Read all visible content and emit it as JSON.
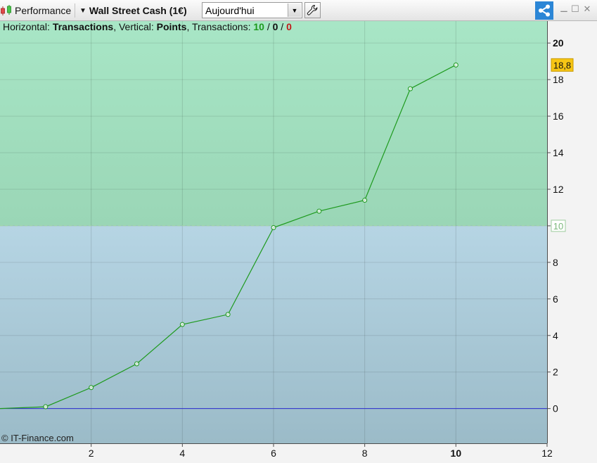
{
  "toolbar": {
    "title": "Performance",
    "instrument": "Wall Street Cash (1€)",
    "period": "Aujourd'hui",
    "icons": [
      "candlestick-icon",
      "wrench-icon",
      "share-icon",
      "minimize-icon",
      "maximize-icon",
      "close-icon"
    ],
    "colors": {
      "share_bg": "#2b86d6"
    }
  },
  "header": {
    "horizontal_label": "Horizontal: ",
    "horizontal_value": "Transactions",
    "vertical_label": ", Vertical: ",
    "vertical_value": "Points",
    "transactions_label": ", Transactions: ",
    "tx_win": "10",
    "tx_sep1": " / ",
    "tx_neutral": "0",
    "tx_sep2": " / ",
    "tx_loss": "0"
  },
  "watermark": "© IT-Finance.com",
  "chart_data": {
    "type": "line",
    "x": [
      0,
      1,
      2,
      3,
      4,
      5,
      6,
      7,
      8,
      9,
      10
    ],
    "y": [
      0,
      0.1,
      1.15,
      2.45,
      4.6,
      5.15,
      9.9,
      10.8,
      11.4,
      17.5,
      18.8
    ],
    "xlim": [
      0,
      12
    ],
    "ylim": [
      -1.9,
      21.2
    ],
    "x_ticks": [
      2,
      4,
      6,
      8,
      10,
      12
    ],
    "x_tick_labels": [
      "2",
      "4",
      "6",
      "8",
      "10",
      "12"
    ],
    "y_ticks": [
      0,
      2,
      4,
      6,
      8,
      10,
      12,
      14,
      16,
      18,
      20
    ],
    "y_tick_labels": [
      "0",
      "2",
      "4",
      "6",
      "8",
      "",
      "12",
      "14",
      "16",
      "18",
      "20"
    ],
    "current_value_label": "18,8",
    "reference_value": 10,
    "reference_label": "10",
    "grid": true,
    "colors": {
      "line": "#1e9a1e",
      "zero_line": "#2b2bd0",
      "upper_zone_top": "#a8e6c6",
      "upper_zone_bottom": "#9ad6b6",
      "lower_zone_top": "#b6d5e4",
      "lower_zone_bottom": "#9bbbc8",
      "current_badge": "#f6c515",
      "win": "#1e9a1e",
      "loss": "#c01a1a"
    }
  }
}
